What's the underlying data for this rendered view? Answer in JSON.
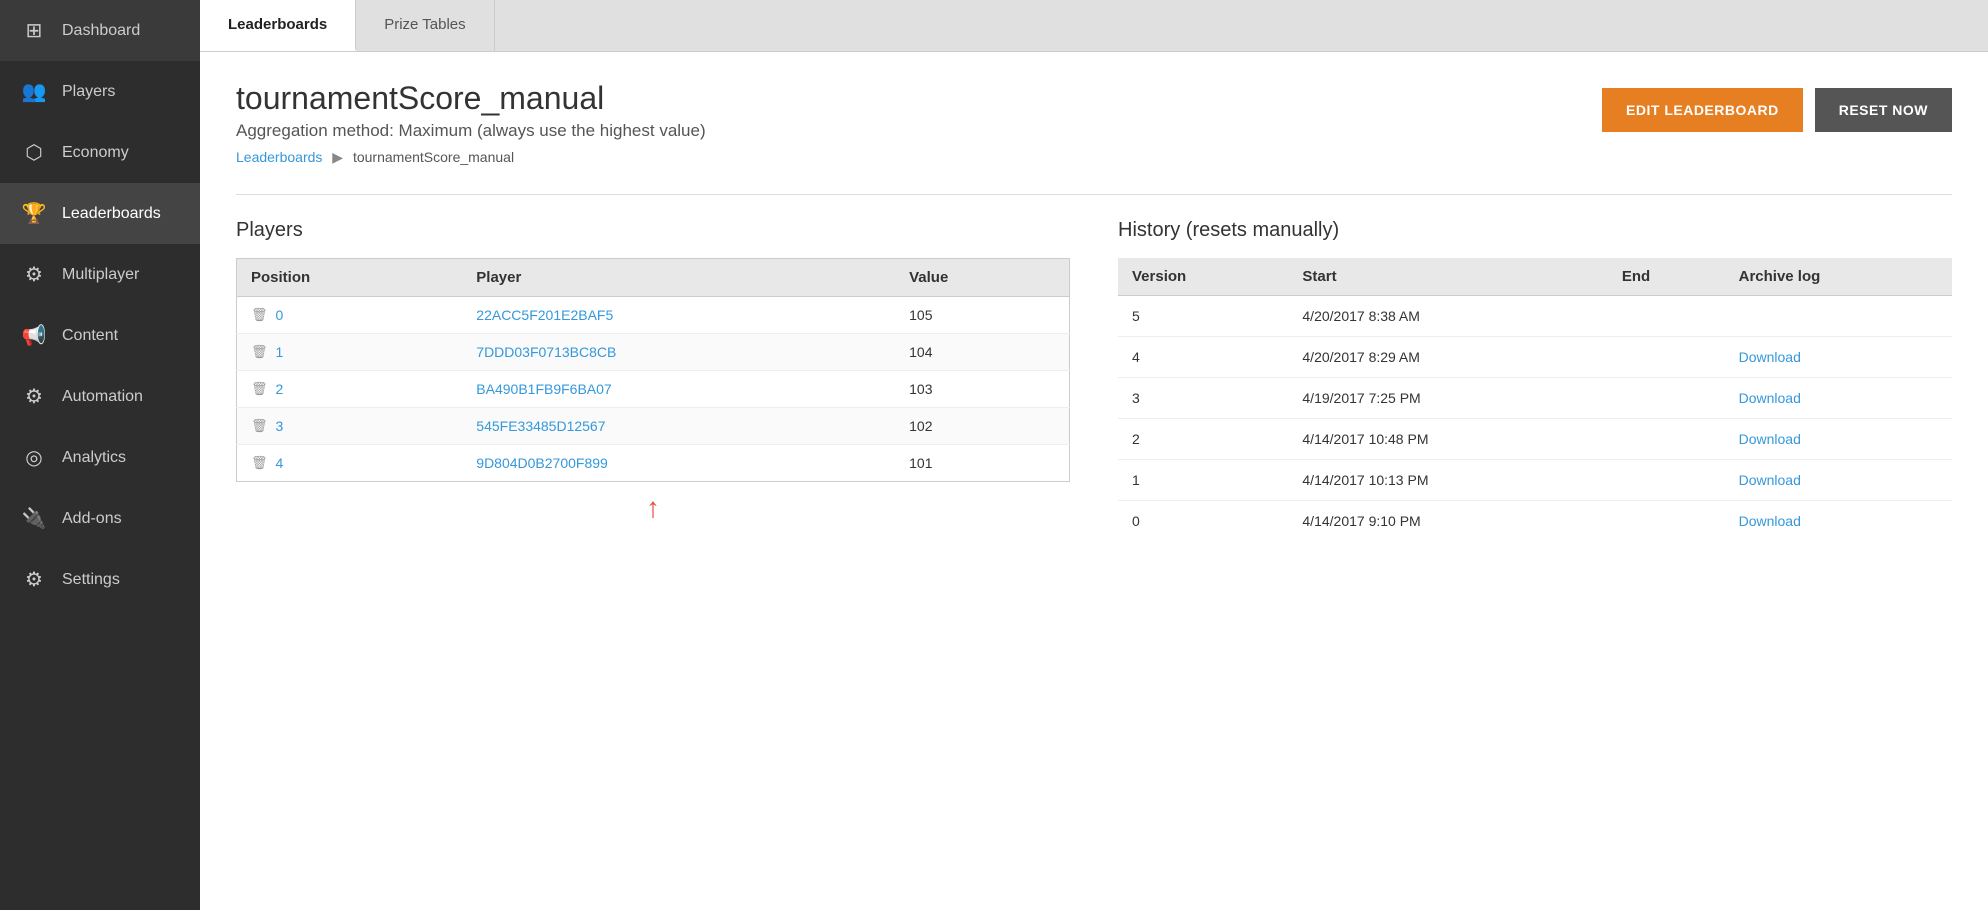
{
  "sidebar": {
    "items": [
      {
        "label": "Dashboard",
        "icon": "⊞",
        "active": false
      },
      {
        "label": "Players",
        "icon": "👥",
        "active": false
      },
      {
        "label": "Economy",
        "icon": "⬡",
        "active": false
      },
      {
        "label": "Leaderboards",
        "icon": "🏆",
        "active": true
      },
      {
        "label": "Multiplayer",
        "icon": "⚙",
        "active": false
      },
      {
        "label": "Content",
        "icon": "📢",
        "active": false
      },
      {
        "label": "Automation",
        "icon": "⚙",
        "active": false
      },
      {
        "label": "Analytics",
        "icon": "◎",
        "active": false
      },
      {
        "label": "Add-ons",
        "icon": "🔌",
        "active": false
      },
      {
        "label": "Settings",
        "icon": "⚙",
        "active": false
      }
    ]
  },
  "tabs": [
    {
      "label": "Leaderboards",
      "active": true
    },
    {
      "label": "Prize Tables",
      "active": false
    }
  ],
  "header": {
    "title": "tournamentScore_manual",
    "subtitle": "Aggregation method: Maximum (always use the highest value)",
    "edit_label": "EDIT LEADERBOARD",
    "reset_label": "RESET NOW"
  },
  "breadcrumb": {
    "parent_label": "Leaderboards",
    "current": "tournamentScore_manual"
  },
  "players": {
    "section_title": "Players",
    "columns": [
      "Position",
      "Player",
      "Value"
    ],
    "rows": [
      {
        "position": "0",
        "player": "22ACC5F201E2BAF5",
        "value": "105"
      },
      {
        "position": "1",
        "player": "7DDD03F0713BC8CB",
        "value": "104"
      },
      {
        "position": "2",
        "player": "BA490B1FB9F6BA07",
        "value": "103"
      },
      {
        "position": "3",
        "player": "545FE33485D12567",
        "value": "102"
      },
      {
        "position": "4",
        "player": "9D804D0B2700F899",
        "value": "101"
      }
    ]
  },
  "history": {
    "section_title": "History (resets manually)",
    "columns": [
      "Version",
      "Start",
      "End",
      "Archive log"
    ],
    "rows": [
      {
        "version": "5",
        "start": "4/20/2017 8:38 AM",
        "end": "",
        "download": ""
      },
      {
        "version": "4",
        "start": "4/20/2017 8:29 AM",
        "end": "",
        "download": "Download"
      },
      {
        "version": "3",
        "start": "4/19/2017 7:25 PM",
        "end": "",
        "download": "Download"
      },
      {
        "version": "2",
        "start": "4/14/2017 10:48 PM",
        "end": "",
        "download": "Download"
      },
      {
        "version": "1",
        "start": "4/14/2017 10:13 PM",
        "end": "",
        "download": "Download"
      },
      {
        "version": "0",
        "start": "4/14/2017 9:10 PM",
        "end": "",
        "download": "Download"
      }
    ]
  }
}
